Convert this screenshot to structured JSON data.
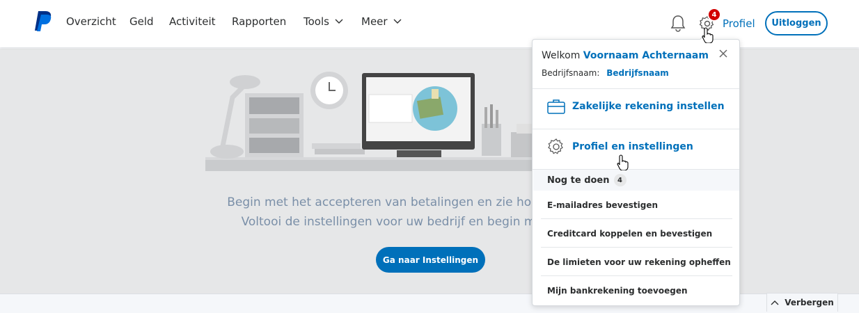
{
  "nav": {
    "items": [
      {
        "label": "Overzicht",
        "dropdown": false
      },
      {
        "label": "Geld",
        "dropdown": false
      },
      {
        "label": "Activiteit",
        "dropdown": false
      },
      {
        "label": "Rapporten",
        "dropdown": false
      },
      {
        "label": "Tools",
        "dropdown": true
      },
      {
        "label": "Meer",
        "dropdown": true
      }
    ],
    "notification_count": "4",
    "profile_label": "Profiel",
    "logout_label": "Uitloggen"
  },
  "hero": {
    "line1": "Begin met het accepteren van betalingen en zie hoe u",
    "line2": "Voltooi de instellingen voor uw bedrijf en begin m",
    "cta_label": "Ga naar Instellingen"
  },
  "profile_menu": {
    "welcome_prefix": "Welkom",
    "user_name": "Voornaam Achternaam",
    "company_label": "Bedrijfsnaam:",
    "company_name": "Bedrijfsnaam",
    "links": [
      {
        "label": "Zakelijke rekening instellen",
        "icon": "briefcase-icon"
      },
      {
        "label": "Profiel en instellingen",
        "icon": "gear-icon"
      }
    ],
    "todo_title": "Nog te doen",
    "todo_count": "4",
    "todo_items": [
      "E-mailadres bevestigen",
      "Creditcard koppelen en bevestigen",
      "De limieten voor uw rekening opheffen",
      "Mijn bankrekening toevoegen"
    ]
  },
  "hide_label": "Verbergen",
  "colors": {
    "brand_blue": "#0070ba",
    "badge_red": "#d20000",
    "hero_bg": "#e6e7e8"
  }
}
